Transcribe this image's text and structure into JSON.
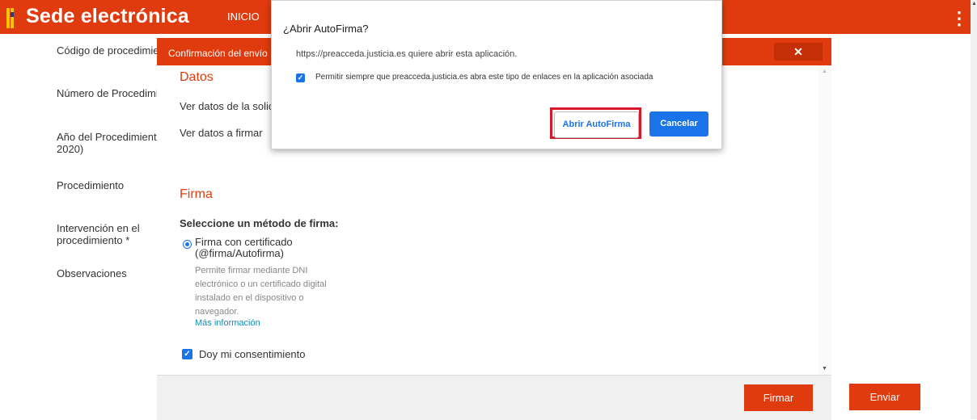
{
  "header": {
    "brand": "Sede electrónica",
    "nav_inicio": "INICIO",
    "menu_icon": "⋮"
  },
  "form": {
    "labels": [
      "Código de procedimiento",
      "Número de Procedimiento",
      "Año del Procedimiento",
      "2020)",
      "Procedimiento",
      "Intervención en el",
      "procedimiento *",
      "Observaciones"
    ],
    "enviar_label": "Enviar"
  },
  "modal": {
    "title": "Confirmación del envío",
    "close_icon": "✕",
    "datos_title": "Datos",
    "ver_solicitud": "Ver datos de la solicitud",
    "ver_firmar": "Ver datos a firmar",
    "firma_title": "Firma",
    "method_label": "Seleccione un método de firma:",
    "radio_label_1": "Firma con certificado",
    "radio_label_2": "(@firma/Autofirma)",
    "radio_desc_lines": [
      "Permite firmar mediante DNI",
      "electrónico o un certificado digital",
      "instalado en el dispositivo o",
      "navegador."
    ],
    "more_info": "Más información",
    "consent_label": "Doy mi consentimiento",
    "firmar_label": "Firmar"
  },
  "dialog": {
    "title": "¿Abrir AutoFirma?",
    "url_text": "https://preacceda.justicia.es quiere abrir esta aplicación.",
    "always_allow": "Permitir siempre que preacceda.justicia.es abra este tipo de enlaces en la aplicación asociada",
    "open_label": "Abrir AutoFirma",
    "cancel_label": "Cancelar"
  },
  "colors": {
    "brand_red": "#e03b0e",
    "link_blue": "#1a73e8",
    "highlight_red": "#d7182a"
  }
}
